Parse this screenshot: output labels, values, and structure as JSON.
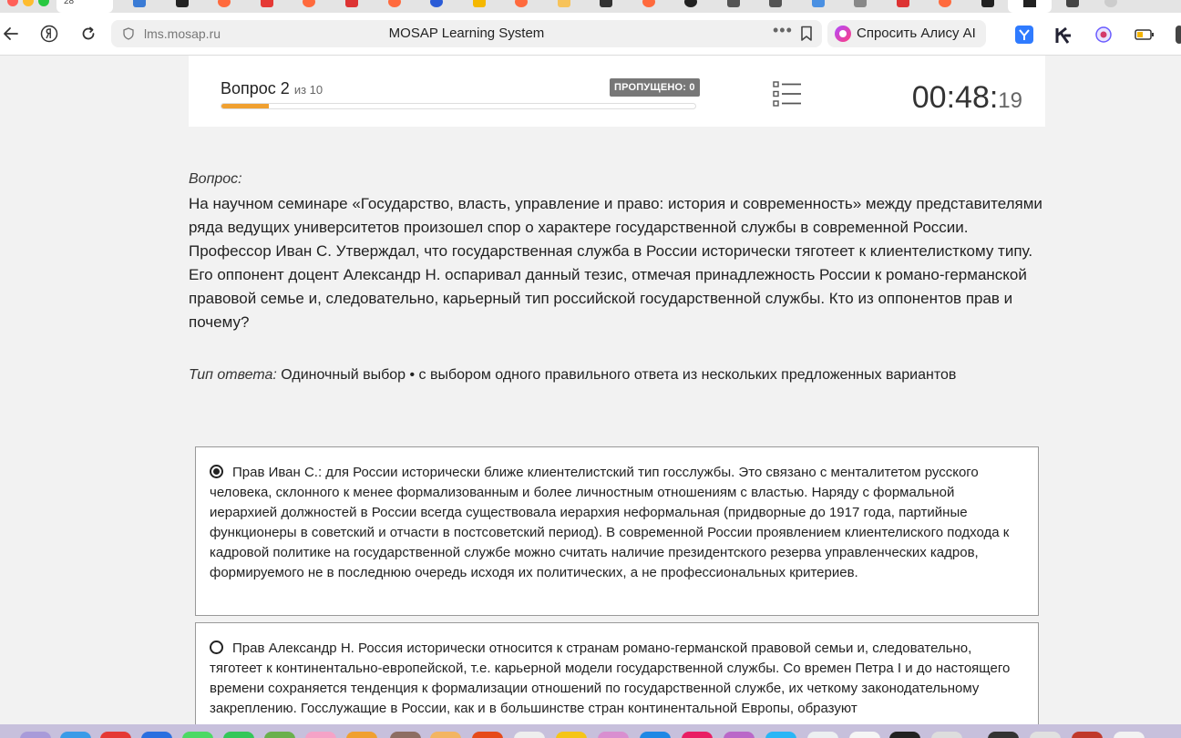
{
  "browser": {
    "url": "lms.mosap.ru",
    "title": "MOSAP Learning System",
    "more": "•••",
    "alice_label": "Спросить Алису AI",
    "tab_label": "28"
  },
  "header": {
    "question_label": "Вопрос 2",
    "question_total": "из 10",
    "skipped": "ПРОПУЩЕНО: 0",
    "progress": 0.1,
    "timer_main": "00:48:",
    "timer_sec": "19"
  },
  "question": {
    "label": "Вопрос:",
    "text": "На научном семинаре «Государство, власть, управление и право: история и современность» между представителями ряда ведущих университетов произошел спор о характере государственной службы в современной России. Профессор Иван С. Утверждал, что государственная служба в России исторически тяготеет к клиентелисткому типу. Его оппонент доцент Александр Н. оспаривал данный тезис, отмечая принадлежность России к романо-германской правовой семье и, следовательно, карьерный тип российской государственной службы. Кто из оппонентов прав и почему?",
    "type_label": "Тип ответа:",
    "type_value": "Одиночный выбор • с выбором одного правильного ответа из нескольких предложенных вариантов"
  },
  "options": [
    {
      "checked": true,
      "text": "Прав Иван С.: для России исторически ближе клиентелистский тип госслужбы. Это связано с менталитетом русского человека, склонного к менее формализованным и более личностным отношениям с властью. Наряду с формальной иерархией должностей в России всегда существовала иерархия неформальная (придворные до 1917 года, партийные функционеры в советский и отчасти в постсоветский период). В современной России проявлением клиентелиского подхода к кадровой политике на государственной службе можно считать наличие президентского резерва управленческих кадров, формируемого не в последнюю очередь исходя их политических, а не профессиональных критериев."
    },
    {
      "checked": false,
      "text": "Прав Александр Н. Россия исторически относится к странам романо-германской правовой семьи и, следовательно, тяготеет к континентально-европейской, т.е. карьерной модели государственной службы. Со времен Петра I и до настоящего времени сохраняется тенденция к формализации отношений по государственной службе, их четкому законодательному закреплению. Госслужащие в России, как и в большинстве стран континентальной Европы, образуют"
    }
  ],
  "colors": {
    "progress": "#f0a030",
    "skipped_bg": "#777777",
    "page_bg": "#f2f2f2"
  }
}
